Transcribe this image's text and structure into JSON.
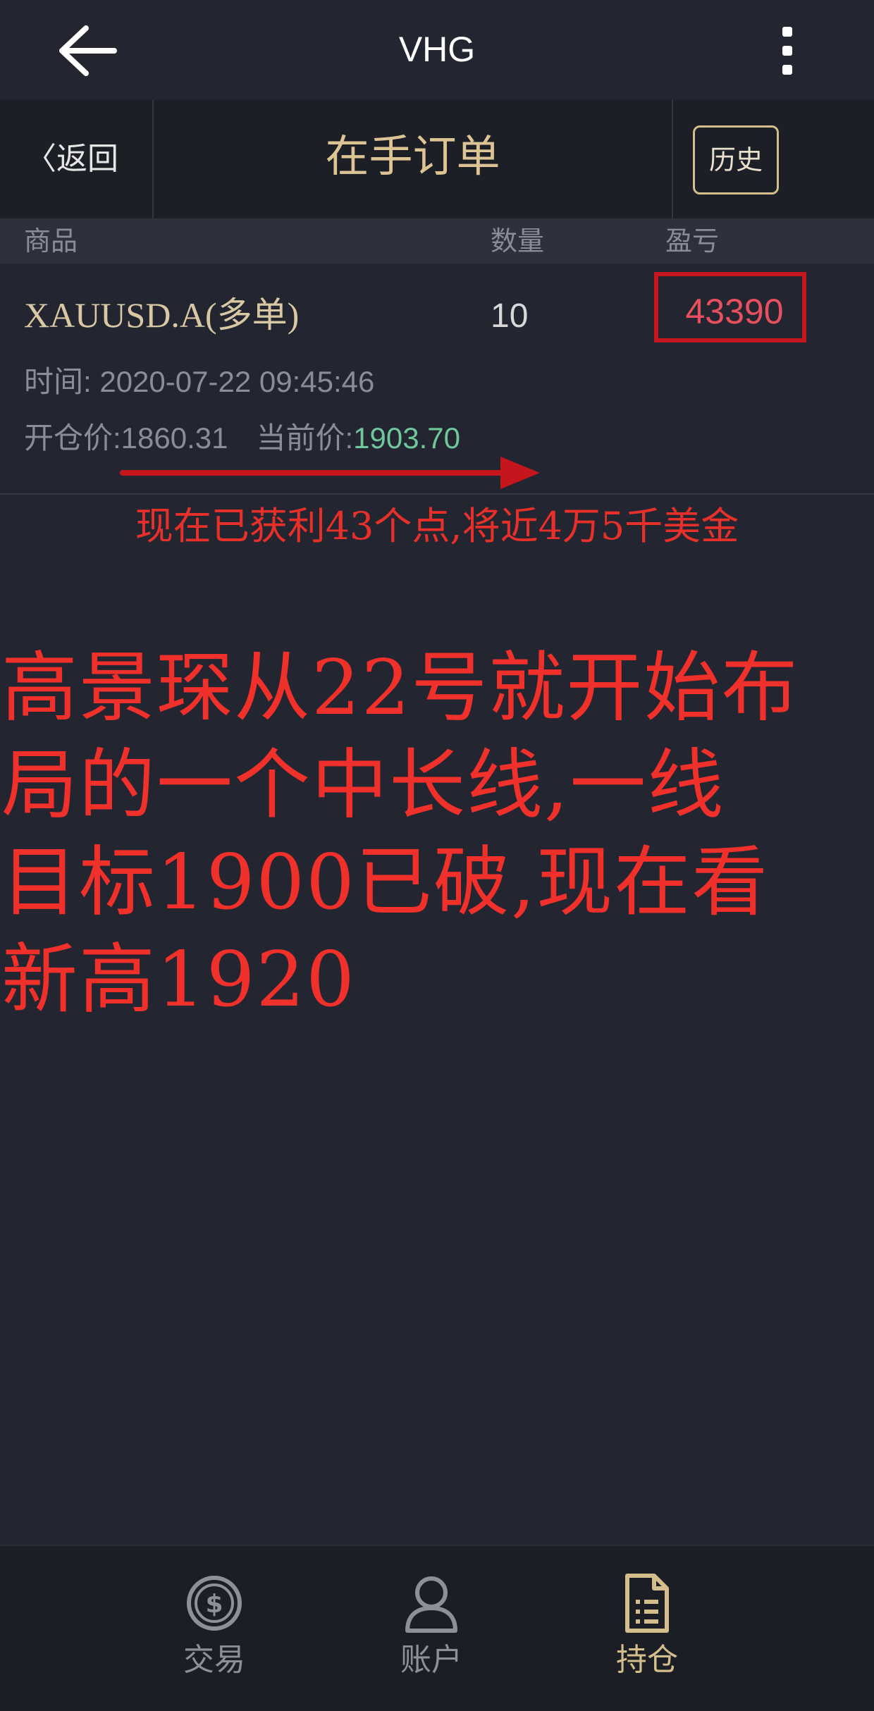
{
  "header": {
    "title": "VHG",
    "back_icon": "arrow-left-icon",
    "menu_icon": "more-vertical-icon"
  },
  "subbar": {
    "back_label": "〈返回",
    "title": "在手订单",
    "history_label": "历史"
  },
  "table": {
    "columns": [
      "商品",
      "数量",
      "盈亏"
    ],
    "rows": [
      {
        "symbol": "XAUUSD.A(多单)",
        "quantity": "10",
        "profit": "43390",
        "time_label": "时间:",
        "time_value": "2020-07-22 09:45:46",
        "open_label": "开仓价:",
        "open_price": "1860.31",
        "current_label": "当前价:",
        "current_price": "1903.70"
      }
    ]
  },
  "annotations": {
    "small_note": "现在已获利43个点,将近4万5千美金",
    "big_note_lines": [
      "高景琛从22号就开始布",
      "局的一个中长线,一线",
      "目标1900已破,现在看",
      "新高1920"
    ]
  },
  "bottom_nav": {
    "items": [
      {
        "label": "交易",
        "icon": "dollar-coin-icon"
      },
      {
        "label": "账户",
        "icon": "user-icon"
      },
      {
        "label": "持仓",
        "icon": "document-list-icon",
        "active": true
      }
    ]
  },
  "colors": {
    "background": "#232530",
    "accent_gold": "#dcc494",
    "profit_red": "#e8505f",
    "price_green": "#6fc79b",
    "annotation_red": "#f0302a"
  }
}
